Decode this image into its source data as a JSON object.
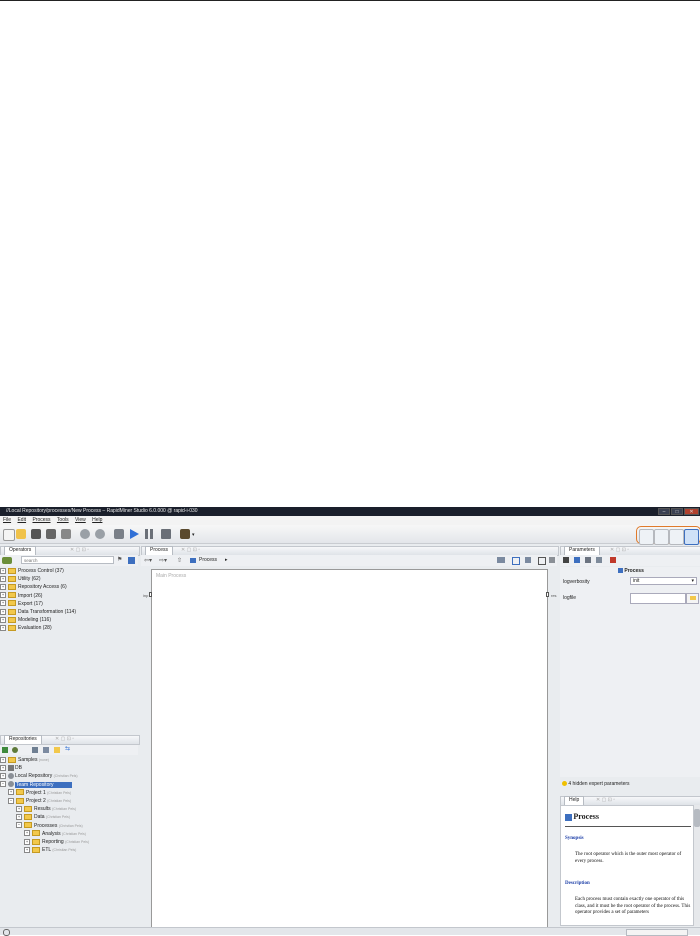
{
  "window": {
    "title": "//Local Repository/processes/New Process – RapidMiner Studio 6.0.000 @ rapid-i-030"
  },
  "menu": [
    "File",
    "Edit",
    "Process",
    "Tools",
    "View",
    "Help"
  ],
  "operators_panel": {
    "tab_label": "Operators",
    "search_placeholder": "search",
    "items": [
      "Process Control (37)",
      "Utility (62)",
      "Repository Access (6)",
      "Import (26)",
      "Export (17)",
      "Data Transformation (114)",
      "Modeling (116)",
      "Evaluation (28)"
    ]
  },
  "repositories_panel": {
    "tab_label": "Repositories",
    "tree": [
      {
        "label": "Samples",
        "sub": "(none)"
      },
      {
        "label": "DB",
        "sub": ""
      },
      {
        "label": "Local Repository",
        "sub": "(Christian Pels)"
      },
      {
        "label": "Team Repository",
        "sub": ""
      },
      {
        "label": "Project 1",
        "sub": "(Christian Pels)"
      },
      {
        "label": "Project 2",
        "sub": "(Christian Pels)"
      },
      {
        "label": "Results",
        "sub": "(Christian Pels)"
      },
      {
        "label": "Data",
        "sub": "(Christian Pels)"
      },
      {
        "label": "Processes",
        "sub": "(Christian Pels)"
      },
      {
        "label": "Analysis",
        "sub": "(Christian Pels)"
      },
      {
        "label": "Reporting",
        "sub": "(Christian Pels)"
      },
      {
        "label": "ETL",
        "sub": "(Christian Pels)"
      }
    ]
  },
  "process_panel": {
    "tab_label": "Process",
    "breadcrumb": "Process",
    "canvas_label": "Main Process",
    "port_left": "inp",
    "port_right": "res"
  },
  "parameters_panel": {
    "tab_label": "Parameters",
    "operator_name": "Process",
    "params": [
      {
        "name": "logverbosity",
        "value": "init"
      },
      {
        "name": "logfile",
        "value": ""
      }
    ],
    "expert_note": "4 hidden expert parameters"
  },
  "help_panel": {
    "tab_label": "Help",
    "title": "Process",
    "synopsis_heading": "Synopsis",
    "synopsis_text": "The root operator which is the outer most operator of every process.",
    "description_heading": "Description",
    "description_text": "Each process must contain exactly one operator of this class, and it must be the root operator of the process. This operator provides a set of parameters"
  },
  "colors": {
    "accent_orange": "#e07a2a",
    "selection_blue": "#3d6fbf",
    "folder_yellow": "#f2c84b"
  }
}
